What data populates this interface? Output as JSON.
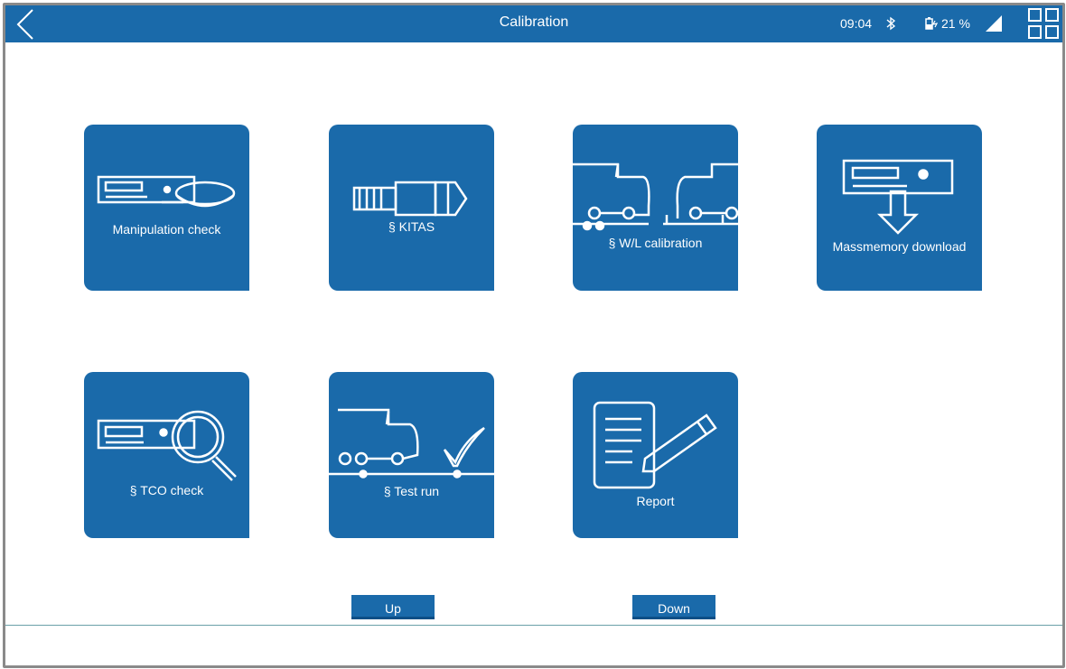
{
  "header": {
    "title": "Calibration",
    "time": "09:04",
    "battery": "21 %",
    "icons": [
      "back-arrow-icon",
      "bluetooth-icon",
      "battery-charging-icon",
      "signal-icon",
      "grid-menu-icon"
    ]
  },
  "tiles": [
    {
      "label": "Manipulation check",
      "icon": "tachograph-sensor-icon"
    },
    {
      "label": "§ KITAS",
      "icon": "kitas-sensor-icon"
    },
    {
      "label": "§ W/L calibration",
      "icon": "truck-calibration-icon"
    },
    {
      "label": "Massmemory download",
      "icon": "download-icon"
    },
    {
      "label": "§ TCO check",
      "icon": "magnifier-icon"
    },
    {
      "label": "§ Test run",
      "icon": "truck-checkmark-icon"
    },
    {
      "label": "Report",
      "icon": "report-pen-icon"
    }
  ],
  "pager": {
    "up": "Up",
    "down": "Down"
  },
  "colors": {
    "accent": "#1a6aaa",
    "frame": "#8a8a8a"
  }
}
